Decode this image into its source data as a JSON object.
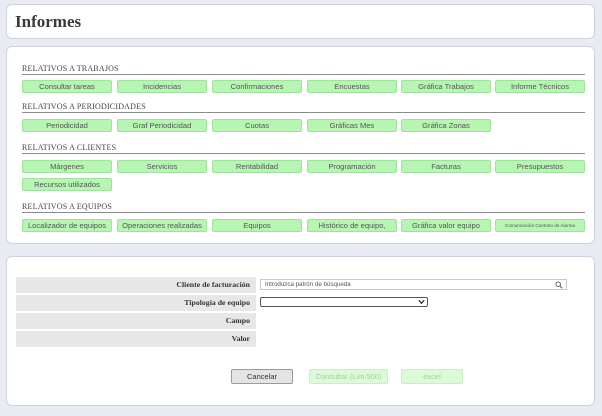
{
  "header": {
    "title": "Informes"
  },
  "sections": [
    {
      "title": "RELATIVOS A TRABAJOS",
      "buttons": [
        "Consultar tareas",
        "Incidencias",
        "Confirmaciones",
        "Encuestas",
        "Gráfica Trabajos",
        "Informe Técnicos"
      ]
    },
    {
      "title": "RELATIVOS A PERIODICIDADES",
      "buttons": [
        "Periodicidad",
        "Graf Periodicidad",
        "Cuotas",
        "Gráficas Mes",
        "Gráfica Zonas"
      ]
    },
    {
      "title": "RELATIVOS A CLIENTES",
      "buttons": [
        "Márgenes",
        "Servicios",
        "Rentabilidad",
        "Programación",
        "Facturas",
        "Presupuestos",
        "Recursos utilizados"
      ]
    },
    {
      "title": "RELATIVOS A EQUIPOS",
      "buttons": [
        "Localizador de equipos",
        "Operaciones realizadas",
        "Equipos",
        "Histórico de equipo,",
        "Gráfica valor equipo",
        "Comunicación Contrato de Alarma"
      ]
    }
  ],
  "filters": {
    "cliente_label": "Cliente de facturación",
    "cliente_placeholder": "Introduzca patrón de búsqueda",
    "tipologia_label": "Tipología de equipo",
    "tipologia_value": "",
    "campo_label": "Campo",
    "valor_label": "Valor"
  },
  "actions": {
    "cancel_label": "Cancelar",
    "consultar_label": "Consultar (Lim 500)",
    "excel_label": "excel"
  },
  "colors": {
    "report_button_bg": "#b7f5b3",
    "report_button_border": "#9ee39b",
    "disabled_button_bg": "#dafad8"
  }
}
